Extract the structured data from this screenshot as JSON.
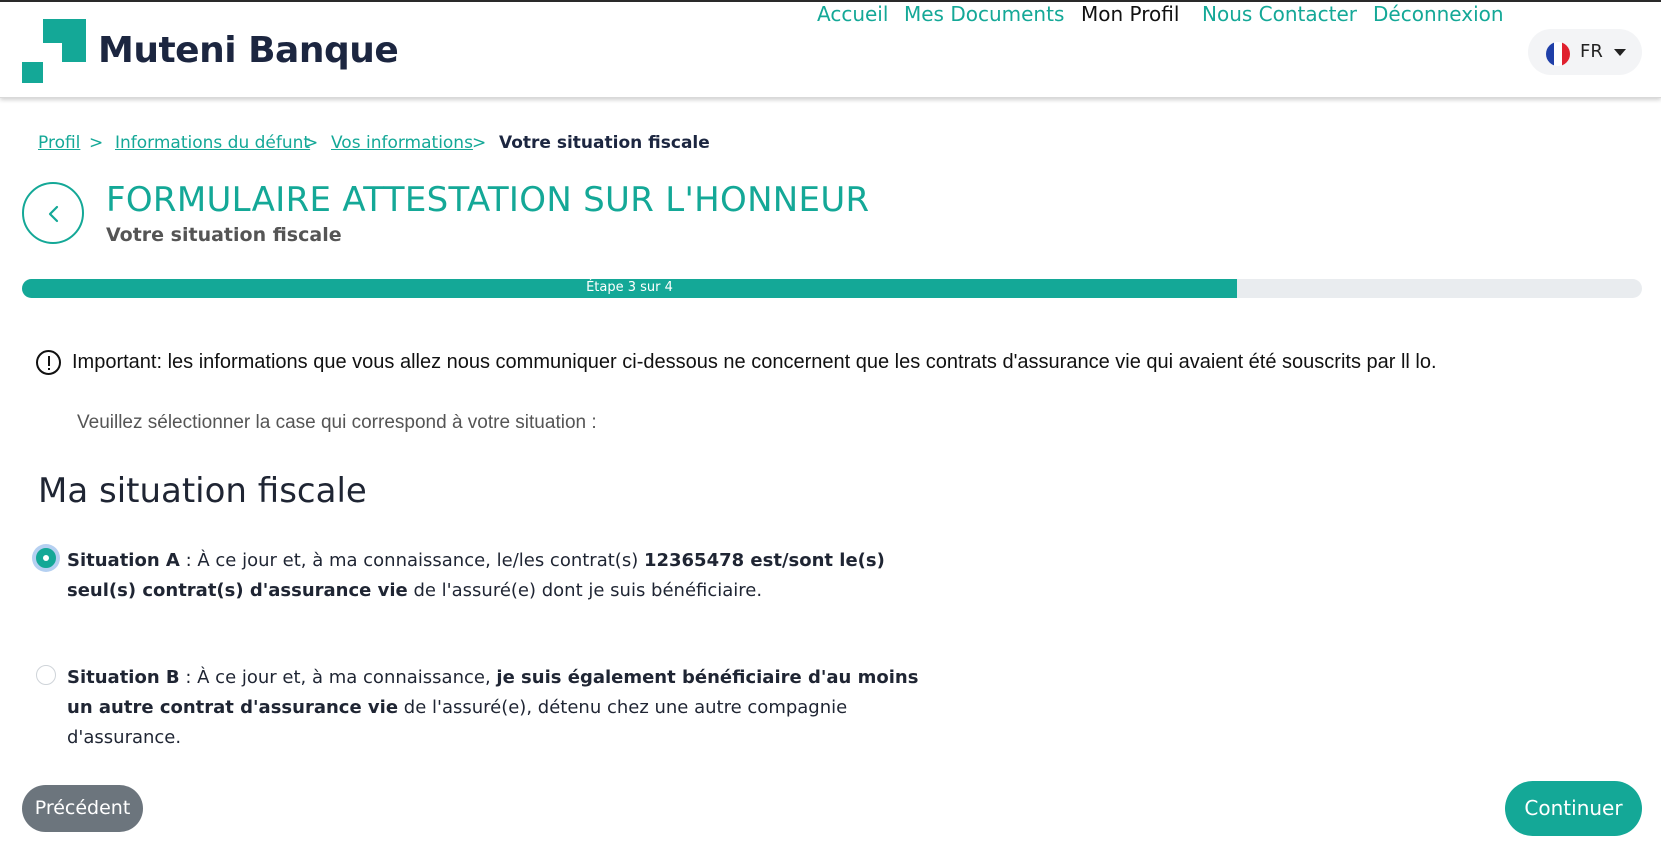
{
  "brand": {
    "name": "Muteni Banque"
  },
  "nav": {
    "items": [
      {
        "label": "Accueil",
        "active": false
      },
      {
        "label": "Mes Documents",
        "active": false
      },
      {
        "label": "Mon Profil",
        "active": true
      },
      {
        "label": "Nous Contacter",
        "active": false
      },
      {
        "label": "Déconnexion",
        "active": false
      }
    ],
    "language": {
      "label": "FR",
      "flag": "france-flag-icon"
    }
  },
  "breadcrumb": {
    "items": [
      "Profil",
      "Informations du défunt",
      "Vos informations"
    ],
    "separator": ">",
    "current": "Votre situation fiscale"
  },
  "page": {
    "title": "FORMULAIRE ATTESTATION SUR L'HONNEUR",
    "subtitle": "Votre situation fiscale"
  },
  "progress": {
    "label": "Étape 3 sur 4",
    "fraction": 0.75
  },
  "notice": {
    "icon": "exclamation-circle-icon",
    "text": "Important: les informations que vous allez nous communiquer ci-dessous ne concernent que les contrats d'assurance vie qui avaient été souscrits par ll lo."
  },
  "instruction": "Veuillez sélectionner la case qui correspond à votre situation :",
  "section": {
    "title": "Ma situation fiscale"
  },
  "options": [
    {
      "checked": true,
      "label": "Situation A",
      "part1": " : À ce jour et, à ma connaissance, le/les contrat(s) ",
      "bold": "12365478 est/sont le(s) seul(s) contrat(s) d'assurance vie",
      "part2": " de l'assuré(e) dont je suis bénéficiaire."
    },
    {
      "checked": false,
      "label": "Situation B",
      "part1": " : À ce jour et, à ma connaissance, ",
      "bold": "je suis également bénéficiaire d'au moins un autre contrat d'assurance vie",
      "part2": " de l'assuré(e), détenu chez une autre compagnie d'assurance."
    }
  ],
  "buttons": {
    "previous": "Précédent",
    "next": "Continuer"
  },
  "colors": {
    "accent": "#14a897",
    "dark": "#1c2640",
    "secondary_button": "#6c757d",
    "progress_track": "#e9ecef"
  }
}
